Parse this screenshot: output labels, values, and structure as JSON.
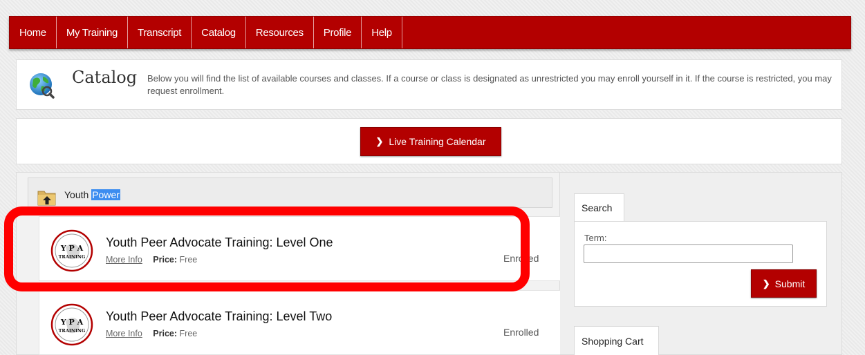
{
  "nav": {
    "items": [
      "Home",
      "My Training",
      "Transcript",
      "Catalog",
      "Resources",
      "Profile",
      "Help"
    ]
  },
  "catalog": {
    "title": "Catalog",
    "description": "Below you will find the list of available courses and classes. If a course or class is designated as unrestricted you may enroll yourself in it. If the course is restricted, you may request enrollment."
  },
  "calendar_button": {
    "label": "Live Training Calendar"
  },
  "folder": {
    "label_plain": "Youth ",
    "label_highlight": "Power"
  },
  "courses": [
    {
      "title": "Youth Peer Advocate Training: Level One",
      "more_info": "More Info",
      "price_label": "Price:",
      "price": "Free",
      "status": "Enrolled",
      "logo_text_top": "Y P A",
      "logo_text_bottom": "TRAINING"
    },
    {
      "title": "Youth Peer Advocate Training: Level Two",
      "more_info": "More Info",
      "price_label": "Price:",
      "price": "Free",
      "status": "Enrolled",
      "logo_text_top": "Y P A",
      "logo_text_bottom": "TRAINING"
    }
  ],
  "search": {
    "tab_label": "Search",
    "term_label": "Term:",
    "term_value": "",
    "submit_label": "Submit"
  },
  "cart": {
    "tab_label": "Shopping Cart"
  },
  "colors": {
    "brand_red": "#b30000",
    "highlight_red": "#ff0000",
    "selection_blue": "#3c8df0"
  }
}
